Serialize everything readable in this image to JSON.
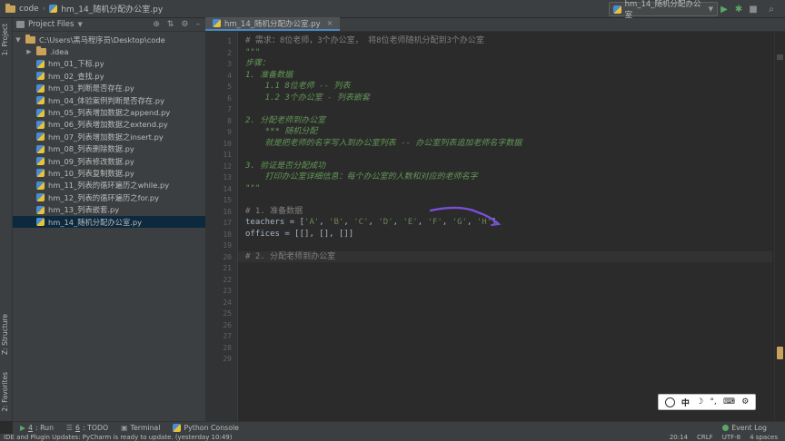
{
  "topbar": {
    "project_name": "code",
    "file_name": "hm_14_随机分配办公室.py",
    "run_config": "hm_14_随机分配办公室"
  },
  "left_strip": {
    "project_tab": "1: Project",
    "structure_tab": "Z: Structure",
    "favorites_tab": "2: Favorites"
  },
  "project_panel": {
    "title": "Project Files",
    "root": "C:\\Users\\黑马程序员\\Desktop\\code",
    "folders": [
      ".idea"
    ],
    "files": [
      "hm_01_下标.py",
      "hm_02_查找.py",
      "hm_03_判断是否存在.py",
      "hm_04_体验案例判断是否存在.py",
      "hm_05_列表增加数据之append.py",
      "hm_06_列表增加数据之extend.py",
      "hm_07_列表增加数据之insert.py",
      "hm_08_列表删除数据.py",
      "hm_09_列表修改数据.py",
      "hm_10_列表复制数据.py",
      "hm_11_列表的循环遍历之while.py",
      "hm_12_列表的循环遍历之for.py",
      "hm_13_列表嵌套.py",
      "hm_14_随机分配办公室.py"
    ],
    "selected_index": 13
  },
  "editor": {
    "tab_label": "hm_14_随机分配办公室.py",
    "current_line": 20,
    "lines": [
      {
        "n": "1",
        "t": "# 需求：8位老师，3个办公室， 将8位老师随机分配到3个办公室",
        "c": "cm"
      },
      {
        "n": "2",
        "t": "\"\"\"",
        "c": "ds"
      },
      {
        "n": "3",
        "t": "步骤：",
        "c": "ds"
      },
      {
        "n": "4",
        "t": "1. 准备数据",
        "c": "ds"
      },
      {
        "n": "5",
        "t": "    1.1 8位老师 -- 列表",
        "c": "ds"
      },
      {
        "n": "6",
        "t": "    1.2 3个办公室 - 列表嵌套",
        "c": "ds"
      },
      {
        "n": "7",
        "t": "",
        "c": "ds"
      },
      {
        "n": "8",
        "t": "2. 分配老师到办公室",
        "c": "ds"
      },
      {
        "n": "9",
        "t": "    *** 随机分配",
        "c": "ds"
      },
      {
        "n": "10",
        "t": "    就是把老师的名字写入到办公室列表 -- 办公室列表追加老师名字数据",
        "c": "ds"
      },
      {
        "n": "11",
        "t": "",
        "c": "ds"
      },
      {
        "n": "12",
        "t": "3. 验证是否分配成功",
        "c": "ds"
      },
      {
        "n": "13",
        "t": "    打印办公室详细信息：每个办公室的人数和对应的老师名字",
        "c": "ds"
      },
      {
        "n": "14",
        "t": "\"\"\"",
        "c": "ds"
      },
      {
        "n": "15",
        "t": "",
        "c": "op"
      },
      {
        "n": "16",
        "t": "# 1. 准备数据",
        "c": "cm"
      },
      {
        "n": "17",
        "t": "",
        "c": "op"
      },
      {
        "n": "18",
        "t": "offices = [[], [], []]",
        "c": "op"
      },
      {
        "n": "19",
        "t": "",
        "c": "op"
      },
      {
        "n": "20",
        "t": "# 2. 分配老师到办公室",
        "c": "cm"
      },
      {
        "n": "21",
        "t": "",
        "c": "op"
      },
      {
        "n": "22",
        "t": "",
        "c": "op"
      },
      {
        "n": "23",
        "t": "",
        "c": "op"
      },
      {
        "n": "24",
        "t": "",
        "c": "op"
      },
      {
        "n": "25",
        "t": "",
        "c": "op"
      },
      {
        "n": "26",
        "t": "",
        "c": "op"
      },
      {
        "n": "27",
        "t": "",
        "c": "op"
      },
      {
        "n": "28",
        "t": "",
        "c": "op"
      },
      {
        "n": "29",
        "t": "",
        "c": "op"
      }
    ],
    "line17": {
      "prefix": "teachers = [",
      "items": [
        "'A'",
        "'B'",
        "'C'",
        "'D'",
        "'E'",
        "'F'",
        "'G'",
        "'H'"
      ],
      "sep": ", ",
      "suffix": "]"
    }
  },
  "ime_bar": {
    "mode": "中"
  },
  "tool_windows": [
    {
      "key": "4",
      "label": ": Run"
    },
    {
      "key": "6",
      "label": ": TODO"
    },
    {
      "key": "",
      "label": "Terminal"
    },
    {
      "key": "",
      "label": "Python Console"
    }
  ],
  "event_log": "Event Log",
  "status": {
    "message": "IDE and Plugin Updates: PyCharm is ready to update. (yesterday 10:49)",
    "position": "20:14",
    "line_sep": "CRLF",
    "encoding": "UTF-8",
    "indent": "4 spaces"
  }
}
